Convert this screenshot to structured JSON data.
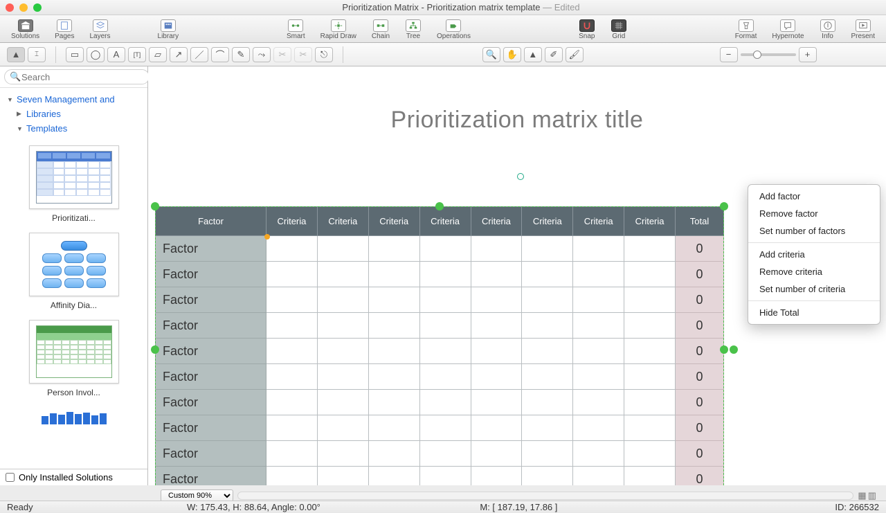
{
  "window": {
    "title": "Prioritization Matrix - Prioritization matrix template",
    "edited": " — Edited"
  },
  "toolbar": {
    "solutions": "Solutions",
    "pages": "Pages",
    "layers": "Layers",
    "library": "Library",
    "smart": "Smart",
    "rapid": "Rapid Draw",
    "chain": "Chain",
    "tree": "Tree",
    "operations": "Operations",
    "snap": "Snap",
    "grid": "Grid",
    "format": "Format",
    "hypernote": "Hypernote",
    "info": "Info",
    "present": "Present"
  },
  "sidebar": {
    "search_placeholder": "Search",
    "section": "Seven Management and",
    "libraries": "Libraries",
    "templates": "Templates",
    "thumbs": [
      "Prioritizati...",
      "Affinity Dia...",
      "Person Invol..."
    ],
    "only_installed": "Only Installed Solutions"
  },
  "matrix": {
    "title": "Prioritization matrix title",
    "header_factor": "Factor",
    "header_criteria": "Criteria",
    "header_total": "Total",
    "criteria_count": 8,
    "rows": [
      "Factor",
      "Factor",
      "Factor",
      "Factor",
      "Factor",
      "Factor",
      "Factor",
      "Factor",
      "Factor",
      "Factor"
    ],
    "totals": [
      "0",
      "0",
      "0",
      "0",
      "0",
      "0",
      "0",
      "0",
      "0",
      "0"
    ]
  },
  "context_menu": {
    "g1": [
      "Add factor",
      "Remove factor",
      "Set number of factors"
    ],
    "g2": [
      "Add criteria",
      "Remove criteria",
      "Set number of criteria"
    ],
    "g3": [
      "Hide Total"
    ]
  },
  "bottom": {
    "zoom": "Custom 90%"
  },
  "status": {
    "ready": "Ready",
    "dims": "W: 175.43,  H: 88.64,  Angle: 0.00°",
    "mouse": "M: [ 187.19, 17.86 ]",
    "id": "ID: 266532"
  }
}
